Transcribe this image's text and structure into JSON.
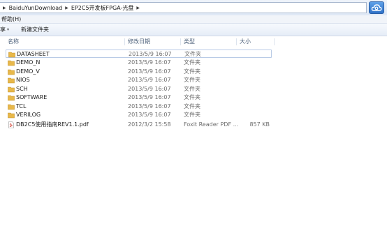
{
  "address": {
    "segments": [
      "BaiduYunDownload",
      "EP2C5开发板FPGA-光盘"
    ]
  },
  "menubar": {
    "help_label": "帮助(H)"
  },
  "toolbar": {
    "partial_label": "享",
    "new_folder_label": "新建文件夹"
  },
  "columns": [
    "名称",
    "修改日期",
    "类型",
    "大小"
  ],
  "files": [
    {
      "name": "DATASHEET",
      "date": "2013/5/9 16:07",
      "type": "文件夹",
      "size": "",
      "icon": "folder-icon"
    },
    {
      "name": "DEMO_N",
      "date": "2013/5/9 16:07",
      "type": "文件夹",
      "size": "",
      "icon": "folder-icon"
    },
    {
      "name": "DEMO_V",
      "date": "2013/5/9 16:07",
      "type": "文件夹",
      "size": "",
      "icon": "folder-icon"
    },
    {
      "name": "NIOS",
      "date": "2013/5/9 16:07",
      "type": "文件夹",
      "size": "",
      "icon": "folder-icon"
    },
    {
      "name": "SCH",
      "date": "2013/5/9 16:07",
      "type": "文件夹",
      "size": "",
      "icon": "folder-icon"
    },
    {
      "name": "SOFTWARE",
      "date": "2013/5/9 16:07",
      "type": "文件夹",
      "size": "",
      "icon": "folder-icon"
    },
    {
      "name": "TCL",
      "date": "2013/5/9 16:07",
      "type": "文件夹",
      "size": "",
      "icon": "folder-icon"
    },
    {
      "name": "VERILOG",
      "date": "2013/5/9 16:07",
      "type": "文件夹",
      "size": "",
      "icon": "folder-icon"
    },
    {
      "name": "DB2C5使用指南REV1.1.pdf",
      "date": "2012/3/2 15:58",
      "type": "Foxit Reader PDF ...",
      "size": "857 KB",
      "icon": "pdf-icon"
    }
  ],
  "colors": {
    "folder": "#e8b84a",
    "accent": "#2f72c8"
  }
}
